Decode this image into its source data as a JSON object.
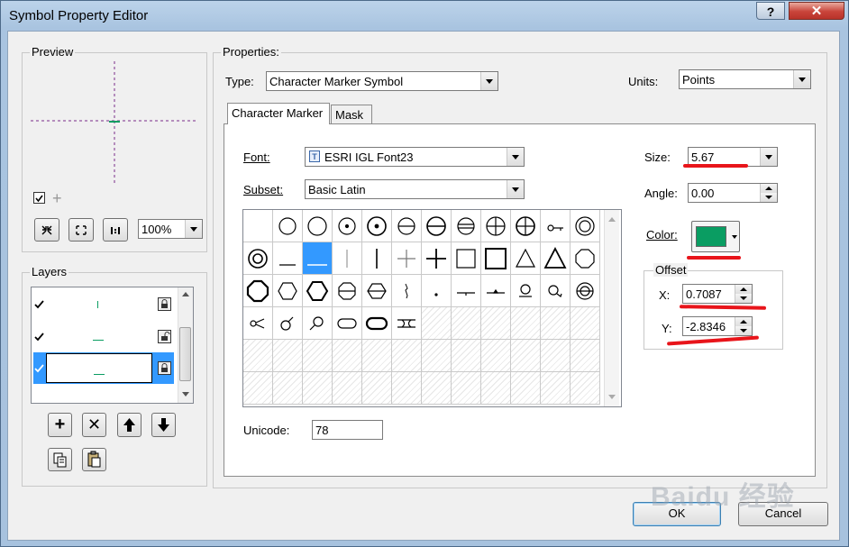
{
  "window": {
    "title": "Symbol Property Editor",
    "help_label": "?",
    "close_label": "✕"
  },
  "preview": {
    "label": "Preview",
    "zoom_value": "100%"
  },
  "layers": {
    "label": "Layers",
    "rows": [
      {
        "checked": true,
        "selected": false
      },
      {
        "checked": true,
        "selected": false
      },
      {
        "checked": true,
        "selected": true
      }
    ]
  },
  "properties": {
    "label": "Properties:",
    "type_label": "Type:",
    "type_value": "Character Marker Symbol",
    "units_label": "Units:",
    "units_value": "Points"
  },
  "tabs": [
    {
      "label": "Character Marker",
      "active": true
    },
    {
      "label": "Mask",
      "active": false
    }
  ],
  "character_marker": {
    "font_label": "Font:",
    "font_value": "ESRI IGL Font23",
    "subset_label": "Subset:",
    "subset_value": "Basic Latin",
    "unicode_label": "Unicode:",
    "unicode_value": "78",
    "size_label": "Size:",
    "size_value": "5.67",
    "angle_label": "Angle:",
    "angle_value": "0.00",
    "color_label": "Color:",
    "color_hex": "#0a9d62",
    "offset_label": "Offset",
    "x_label": "X:",
    "x_value": "0.7087",
    "y_label": "Y:",
    "y_value": "-2.8346"
  },
  "buttons": {
    "ok": "OK",
    "cancel": "Cancel"
  },
  "watermark": "Baidu 经验",
  "colors": {
    "selection": "#3399ff",
    "annotation_red": "#e8141a",
    "preview_line": "#7a2c8a",
    "marker_green": "#0a9d62"
  }
}
